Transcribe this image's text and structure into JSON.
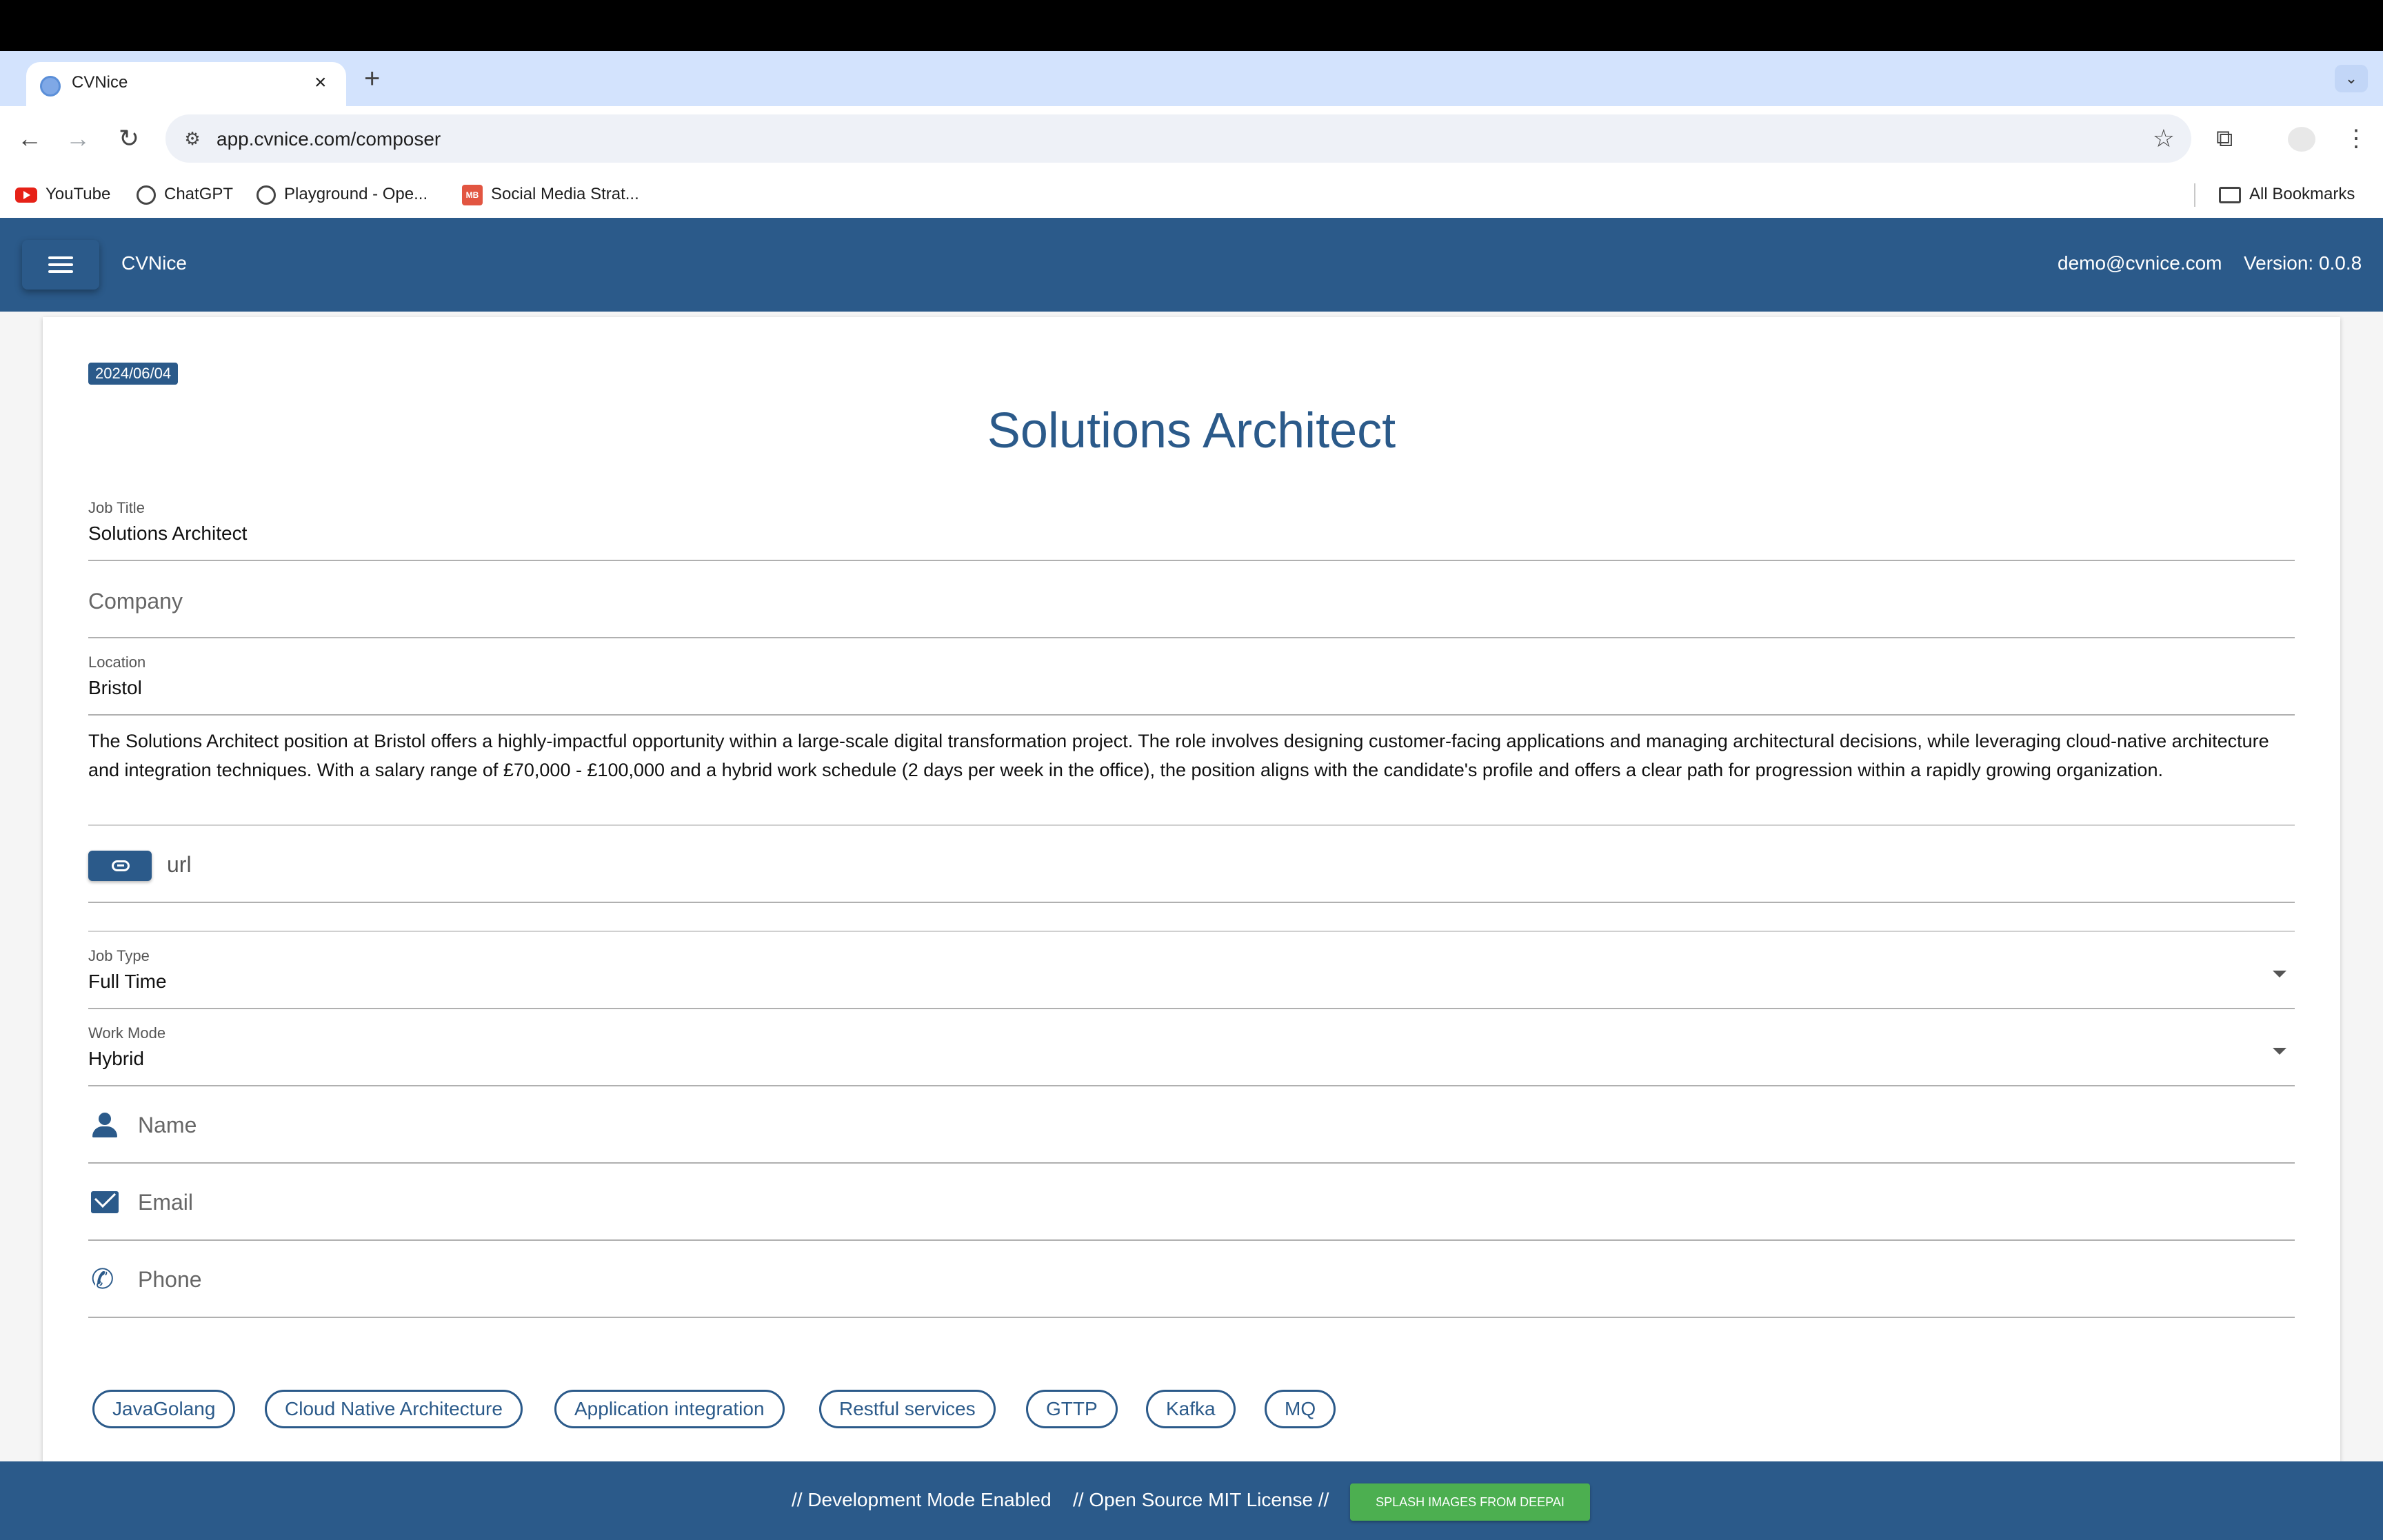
{
  "browser": {
    "tab_title": "CVNice",
    "new_tab_symbol": "+",
    "close_symbol": "×",
    "url": "app.cvnice.com/composer",
    "bookmarks": [
      {
        "label": "YouTube",
        "icon": "youtube-icon"
      },
      {
        "label": "ChatGPT",
        "icon": "chatgpt-icon"
      },
      {
        "label": "Playground - Ope...",
        "icon": "openai-icon"
      },
      {
        "label": "Social Media Strat...",
        "icon": "mb-icon"
      }
    ],
    "all_bookmarks": "All Bookmarks"
  },
  "app": {
    "name": "CVNice",
    "user_email": "demo@cvnice.com",
    "version": "Version: 0.0.8",
    "accent_color": "#2b5a8a"
  },
  "job": {
    "date": "2024/06/04",
    "title": "Solutions Architect",
    "fields": {
      "job_title": {
        "label": "Job Title",
        "value": "Solutions Architect"
      },
      "company": {
        "placeholder": "Company"
      },
      "location": {
        "label": "Location",
        "value": "Bristol"
      },
      "description": "The Solutions Architect position at Bristol offers a highly-impactful opportunity within a large-scale digital transformation project. The role involves designing customer-facing applications and managing architectural decisions, while leveraging cloud-native architecture and integration techniques. With a salary range of £70,000 - £100,000 and a hybrid work schedule (2 days per week in the office), the position aligns with the candidate's profile and offers a clear path for progression within a rapidly growing organization.",
      "url": {
        "placeholder": "url"
      },
      "job_type": {
        "label": "Job Type",
        "value": "Full Time"
      },
      "work_mode": {
        "label": "Work Mode",
        "value": "Hybrid"
      },
      "name": {
        "placeholder": "Name"
      },
      "email": {
        "placeholder": "Email"
      },
      "phone": {
        "placeholder": "Phone"
      }
    },
    "skills": [
      "JavaGolang",
      "Cloud Native Architecture",
      "Application integration",
      "Restful services",
      "GTTP",
      "Kafka",
      "MQ"
    ]
  },
  "footer": {
    "dev_mode": "// Development Mode Enabled",
    "license": "// Open Source MIT License //",
    "splash_button": "SPLASH IMAGES FROM DEEPAI",
    "splash_color": "#4caf50"
  }
}
